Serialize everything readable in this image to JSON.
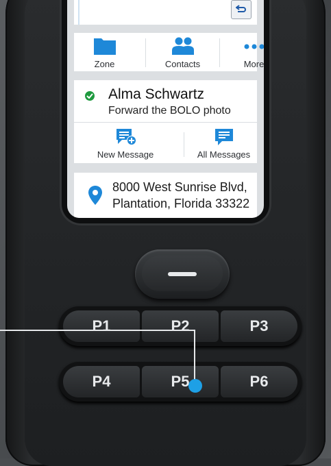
{
  "quick_tabs": [
    {
      "label": "Zone",
      "icon": "folder-icon"
    },
    {
      "label": "Contacts",
      "icon": "contacts-icon"
    },
    {
      "label": "More",
      "icon": "more-icon"
    }
  ],
  "message_card": {
    "contact_name": "Alma Schwartz",
    "message_preview": "Forward the BOLO photo",
    "status_icon": "check-circle-icon",
    "actions": [
      {
        "label": "New Message",
        "icon": "new-message-icon"
      },
      {
        "label": "All Messages",
        "icon": "all-messages-icon"
      }
    ]
  },
  "location_card": {
    "address_line1": "8000 West Sunrise Blvd,",
    "address_line2": "Plantation, Florida 33322",
    "icon": "location-pin-icon"
  },
  "programmable_keys": {
    "row1": [
      "P1",
      "P2",
      "P3"
    ],
    "row2": [
      "P4",
      "P5",
      "P6"
    ]
  },
  "colors": {
    "accent_blue": "#1e88d8",
    "status_green": "#1f9a3f",
    "callout_dot": "#1ea0e6"
  }
}
